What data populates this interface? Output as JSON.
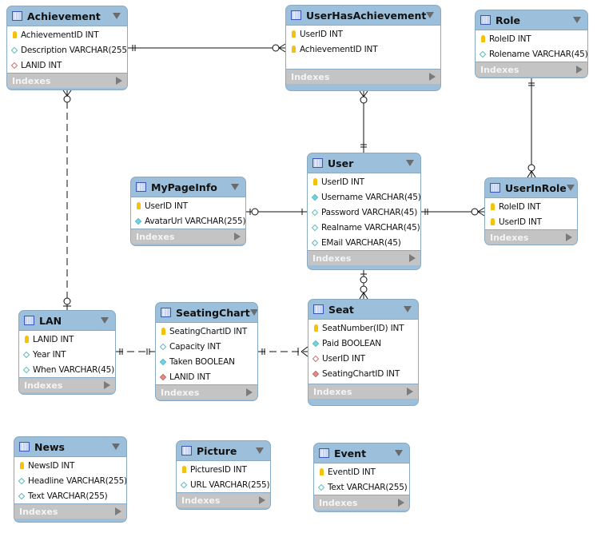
{
  "colors": {
    "header": "#9cc0dc",
    "indexes": "#c4c4c4",
    "key": "#f4c20d",
    "not_null": "#6fd6df",
    "fk": "#e08a8a"
  },
  "tables": [
    {
      "name": "Achievement",
      "indexes_label": "Indexes",
      "columns": [
        {
          "text": "AchievementID INT",
          "icon": "key"
        },
        {
          "text": "Description VARCHAR(255)",
          "icon": "nullable"
        },
        {
          "text": "LANID INT",
          "icon": "fk-nullable"
        }
      ]
    },
    {
      "name": "UserHasAchievement",
      "indexes_label": "Indexes",
      "columns": [
        {
          "text": "UserID INT",
          "icon": "key"
        },
        {
          "text": "AchievementID INT",
          "icon": "key"
        }
      ]
    },
    {
      "name": "Role",
      "indexes_label": "Indexes",
      "columns": [
        {
          "text": "RoleID INT",
          "icon": "key"
        },
        {
          "text": "Rolename VARCHAR(45)",
          "icon": "nullable"
        }
      ]
    },
    {
      "name": "User",
      "indexes_label": "Indexes",
      "columns": [
        {
          "text": "UserID INT",
          "icon": "key"
        },
        {
          "text": "Username VARCHAR(45)",
          "icon": "not-null"
        },
        {
          "text": "Password VARCHAR(45)",
          "icon": "nullable"
        },
        {
          "text": "Realname VARCHAR(45)",
          "icon": "nullable"
        },
        {
          "text": "EMail VARCHAR(45)",
          "icon": "nullable"
        }
      ]
    },
    {
      "name": "MyPageInfo",
      "indexes_label": "Indexes",
      "columns": [
        {
          "text": "UserID INT",
          "icon": "key"
        },
        {
          "text": "AvatarUrl VARCHAR(255)",
          "icon": "not-null"
        }
      ]
    },
    {
      "name": "UserInRole",
      "indexes_label": "Indexes",
      "columns": [
        {
          "text": "RoleID INT",
          "icon": "key"
        },
        {
          "text": "UserID INT",
          "icon": "key"
        }
      ]
    },
    {
      "name": "LAN",
      "indexes_label": "Indexes",
      "columns": [
        {
          "text": "LANID INT",
          "icon": "key"
        },
        {
          "text": "Year INT",
          "icon": "nullable"
        },
        {
          "text": "When VARCHAR(45)",
          "icon": "nullable"
        }
      ]
    },
    {
      "name": "SeatingChart",
      "indexes_label": "Indexes",
      "columns": [
        {
          "text": "SeatingChartID INT",
          "icon": "key"
        },
        {
          "text": "Capacity INT",
          "icon": "nullable"
        },
        {
          "text": "Taken BOOLEAN",
          "icon": "not-null"
        },
        {
          "text": "LANID INT",
          "icon": "fk"
        }
      ]
    },
    {
      "name": "Seat",
      "indexes_label": "Indexes",
      "columns": [
        {
          "text": "SeatNumber(ID) INT",
          "icon": "key"
        },
        {
          "text": "Paid BOOLEAN",
          "icon": "not-null"
        },
        {
          "text": "UserID INT",
          "icon": "fk-nullable"
        },
        {
          "text": "SeatingChartID INT",
          "icon": "fk"
        }
      ]
    },
    {
      "name": "News",
      "indexes_label": "Indexes",
      "columns": [
        {
          "text": "NewsID INT",
          "icon": "key"
        },
        {
          "text": "Headline VARCHAR(255)",
          "icon": "nullable"
        },
        {
          "text": "Text VARCHAR(255)",
          "icon": "nullable"
        }
      ]
    },
    {
      "name": "Picture",
      "indexes_label": "Indexes",
      "columns": [
        {
          "text": "PicturesID INT",
          "icon": "key"
        },
        {
          "text": "URL VARCHAR(255)",
          "icon": "nullable"
        }
      ]
    },
    {
      "name": "Event",
      "indexes_label": "Indexes",
      "columns": [
        {
          "text": "EventID INT",
          "icon": "key"
        },
        {
          "text": "Text VARCHAR(255)",
          "icon": "nullable"
        }
      ]
    }
  ],
  "relationships": [
    {
      "from": "Achievement",
      "to": "UserHasAchievement",
      "identifying": true
    },
    {
      "from": "LAN",
      "to": "Achievement",
      "identifying": false
    },
    {
      "from": "User",
      "to": "UserHasAchievement",
      "identifying": true
    },
    {
      "from": "Role",
      "to": "UserInRole",
      "identifying": true
    },
    {
      "from": "User",
      "to": "MyPageInfo",
      "identifying": true
    },
    {
      "from": "User",
      "to": "UserInRole",
      "identifying": true
    },
    {
      "from": "User",
      "to": "Seat",
      "identifying": true
    },
    {
      "from": "LAN",
      "to": "SeatingChart",
      "identifying": false
    },
    {
      "from": "SeatingChart",
      "to": "Seat",
      "identifying": false
    }
  ]
}
